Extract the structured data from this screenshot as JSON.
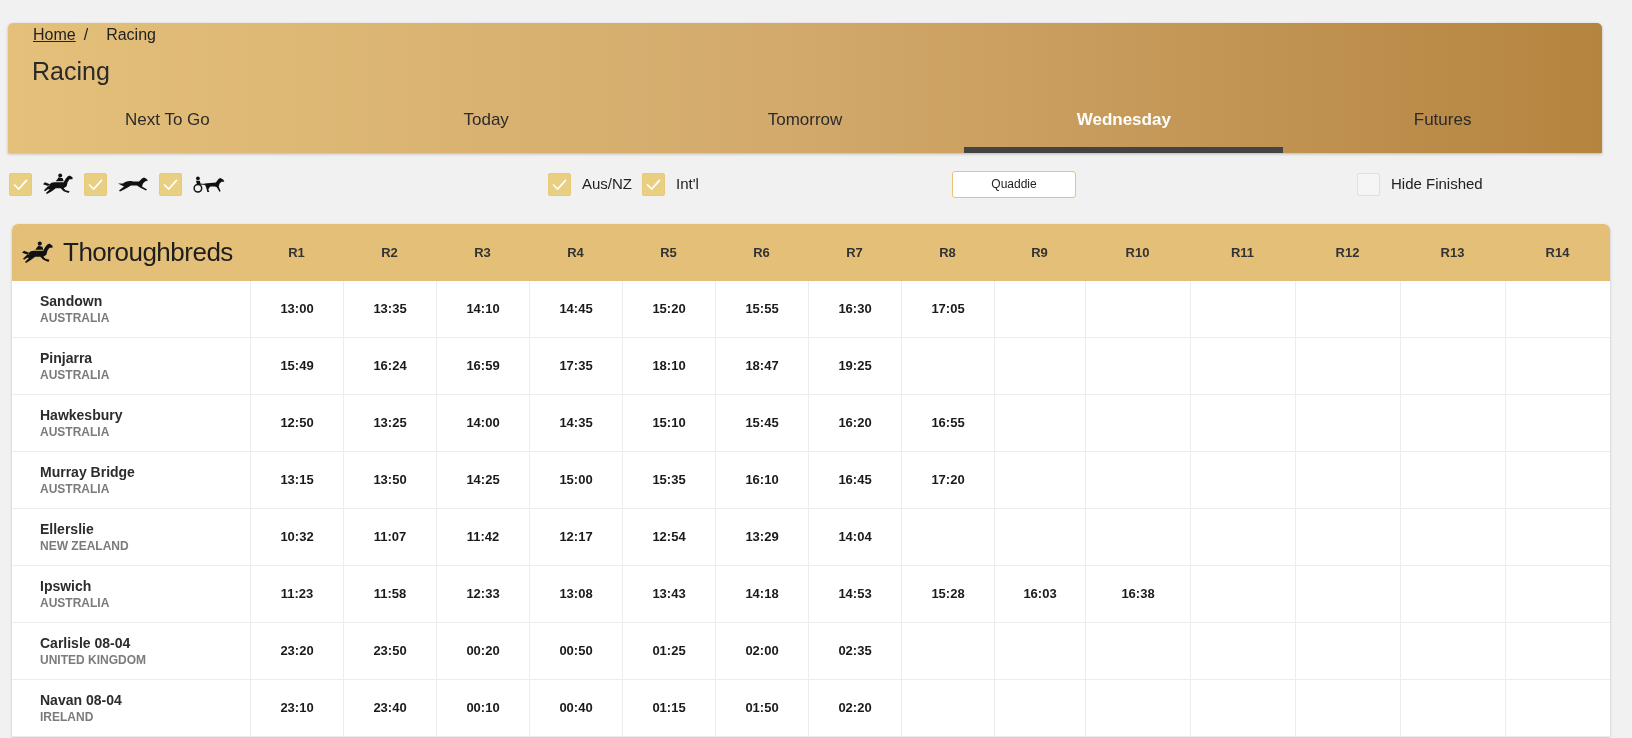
{
  "breadcrumb": {
    "items": [
      {
        "label": "Home",
        "kind": "link"
      },
      {
        "label": "Racing",
        "kind": "current"
      }
    ],
    "separator": "/"
  },
  "title": "Racing",
  "tabs": [
    {
      "label": "Next To Go",
      "selected": false
    },
    {
      "label": "Today",
      "selected": false
    },
    {
      "label": "Tomorrow",
      "selected": false
    },
    {
      "label": "Wednesday",
      "selected": true
    },
    {
      "label": "Futures",
      "selected": false
    }
  ],
  "filters": {
    "race_types": [
      {
        "kind": "horse",
        "checked": true
      },
      {
        "kind": "greyhound",
        "checked": true
      },
      {
        "kind": "harness",
        "checked": true
      }
    ],
    "regions": [
      {
        "label": "Aus/NZ",
        "checked": true
      },
      {
        "label": "Int'l",
        "checked": true
      }
    ],
    "quaddie_button": "Quaddie",
    "hide_finished": {
      "label": "Hide Finished",
      "checked": false
    }
  },
  "table": {
    "title": "Thoroughbreds",
    "columns": [
      "R1",
      "R2",
      "R3",
      "R4",
      "R5",
      "R6",
      "R7",
      "R8",
      "R9",
      "R10",
      "R11",
      "R12",
      "R13",
      "R14"
    ],
    "rows": [
      {
        "venue": "Sandown",
        "country": "AUSTRALIA",
        "times": [
          "13:00",
          "13:35",
          "14:10",
          "14:45",
          "15:20",
          "15:55",
          "16:30",
          "17:05"
        ]
      },
      {
        "venue": "Pinjarra",
        "country": "AUSTRALIA",
        "times": [
          "15:49",
          "16:24",
          "16:59",
          "17:35",
          "18:10",
          "18:47",
          "19:25"
        ]
      },
      {
        "venue": "Hawkesbury",
        "country": "AUSTRALIA",
        "times": [
          "12:50",
          "13:25",
          "14:00",
          "14:35",
          "15:10",
          "15:45",
          "16:20",
          "16:55"
        ]
      },
      {
        "venue": "Murray Bridge",
        "country": "AUSTRALIA",
        "times": [
          "13:15",
          "13:50",
          "14:25",
          "15:00",
          "15:35",
          "16:10",
          "16:45",
          "17:20"
        ]
      },
      {
        "venue": "Ellerslie",
        "country": "NEW ZEALAND",
        "times": [
          "10:32",
          "11:07",
          "11:42",
          "12:17",
          "12:54",
          "13:29",
          "14:04"
        ]
      },
      {
        "venue": "Ipswich",
        "country": "AUSTRALIA",
        "times": [
          "11:23",
          "11:58",
          "12:33",
          "13:08",
          "13:43",
          "14:18",
          "14:53",
          "15:28",
          "16:03",
          "16:38"
        ]
      },
      {
        "venue": "Carlisle 08-04",
        "country": "UNITED KINGDOM",
        "times": [
          "23:20",
          "23:50",
          "00:20",
          "00:50",
          "01:25",
          "02:00",
          "02:35"
        ]
      },
      {
        "venue": "Navan 08-04",
        "country": "IRELAND",
        "times": [
          "23:10",
          "23:40",
          "00:10",
          "00:40",
          "01:15",
          "01:50",
          "02:20"
        ]
      }
    ]
  }
}
